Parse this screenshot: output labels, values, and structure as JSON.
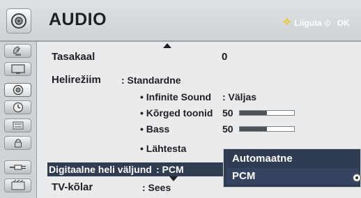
{
  "header": {
    "title": "AUDIO",
    "move_label": "Liiguta",
    "ok_label": "OK"
  },
  "sidebar": {
    "items": [
      {
        "icon": "satellite-dish-icon",
        "active": false
      },
      {
        "icon": "tv-screen-icon",
        "active": false
      },
      {
        "icon": "speaker-icon",
        "active": true
      },
      {
        "icon": "clock-icon",
        "active": false
      },
      {
        "icon": "options-icon",
        "active": false
      },
      {
        "icon": "lock-icon",
        "active": false
      },
      {
        "icon": "input-plug-icon",
        "active": false
      },
      {
        "icon": "usb-media-icon",
        "active": false
      }
    ]
  },
  "menu": {
    "balance_label": "Tasakaal",
    "balance_value": "0",
    "sound_mode_label": "Helirežiim",
    "sound_mode_value": ": Standardne",
    "infinite_sound_label": "• Infinite Sound",
    "infinite_sound_value": ": Väljas",
    "treble_label": "• Kõrged toonid",
    "treble_value": "50",
    "treble_level": 0.5,
    "bass_label": "• Bass",
    "bass_value": "50",
    "bass_level": 0.5,
    "reset_label": "• Lähtesta",
    "digital_out_label": "Digitaalne heli väljund",
    "digital_out_value": ": PCM",
    "tv_speaker_label": "TV-kõlar",
    "tv_speaker_value": ": Sees"
  },
  "popup": {
    "options": [
      "Automaatne",
      "PCM"
    ],
    "selected": "PCM"
  },
  "colors": {
    "highlight": "#303c50",
    "popup_bg": "#2f3b50",
    "move_accent": "#f4c21b"
  }
}
